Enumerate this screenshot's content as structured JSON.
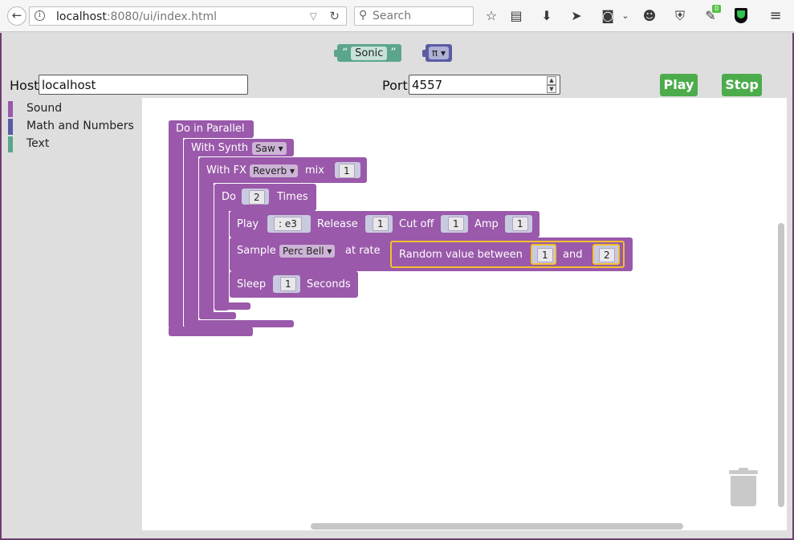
{
  "browser": {
    "back_icon": "back-arrow-icon",
    "url_host": "localhost",
    "url_rest": ":8080/ui/index.html",
    "search_placeholder": "Search",
    "badge_count": "0"
  },
  "app": {
    "top_blocks": {
      "sonic_text": "Sonic",
      "pi_label": "π ▾"
    },
    "host_label": "Host",
    "host_value": "localhost",
    "port_label": "Port",
    "port_value": "4557",
    "play_button": "Play",
    "stop_button": "Stop",
    "toolbox": [
      {
        "label": "Sound",
        "color": "#9a59aa"
      },
      {
        "label": "Math and Numbers",
        "color": "#5b5ba5"
      },
      {
        "label": "Text",
        "color": "#5ba58c"
      }
    ]
  },
  "blocks": {
    "parallel": "Do in Parallel",
    "with_synth": "With Synth",
    "synth_value": "Saw ▾",
    "with_fx": "With FX",
    "fx_value": "Reverb ▾",
    "mix_label": "mix",
    "mix_value": "1",
    "do_label": "Do",
    "do_count": "2",
    "times_label": "Times",
    "play_label": "Play",
    "note_value": ": e3",
    "release_label": "Release",
    "release_value": "1",
    "cutoff_label": "Cut off",
    "cutoff_value": "1",
    "amp_label": "Amp",
    "amp_value": "1",
    "sample_label": "Sample",
    "sample_value": "Perc Bell ▾",
    "rate_label": "at rate",
    "random_label": "Random value between",
    "random_min": "1",
    "and_label": "and",
    "random_max": "2",
    "sleep_label": "Sleep",
    "sleep_value": "1",
    "seconds_label": "Seconds"
  }
}
